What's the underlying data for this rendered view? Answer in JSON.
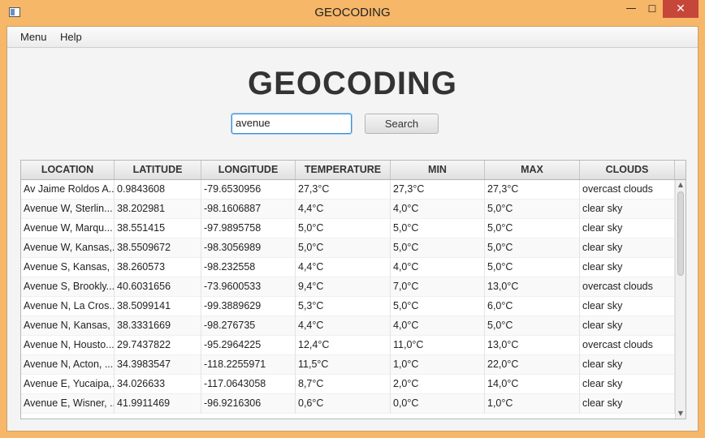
{
  "window": {
    "title": "GEOCODING",
    "minimize_glyph": "—",
    "maximize_glyph": "☐",
    "close_glyph": "✕"
  },
  "menu": {
    "items": [
      "Menu",
      "Help"
    ]
  },
  "main": {
    "heading": "GEOCODING",
    "search_value": "avenue",
    "search_button": "Search"
  },
  "table": {
    "columns": [
      "LOCATION",
      "LATITUDE",
      "LONGITUDE",
      "TEMPERATURE",
      "MIN",
      "MAX",
      "CLOUDS"
    ],
    "rows": [
      [
        "Av Jaime Roldos A...",
        "0.9843608",
        "-79.6530956",
        "27,3°C",
        "27,3°C",
        "27,3°C",
        "overcast clouds"
      ],
      [
        "Avenue W, Sterlin...",
        "38.202981",
        "-98.1606887",
        "4,4°C",
        "4,0°C",
        "5,0°C",
        "clear sky"
      ],
      [
        "Avenue W, Marqu...",
        "38.551415",
        "-97.9895758",
        "5,0°C",
        "5,0°C",
        "5,0°C",
        "clear sky"
      ],
      [
        "Avenue W, Kansas,...",
        "38.5509672",
        "-98.3056989",
        "5,0°C",
        "5,0°C",
        "5,0°C",
        "clear sky"
      ],
      [
        "Avenue S, Kansas, ...",
        "38.260573",
        "-98.232558",
        "4,4°C",
        "4,0°C",
        "5,0°C",
        "clear sky"
      ],
      [
        "Avenue S, Brookly...",
        "40.6031656",
        "-73.9600533",
        "9,4°C",
        "7,0°C",
        "13,0°C",
        "overcast clouds"
      ],
      [
        "Avenue N, La Cros...",
        "38.5099141",
        "-99.3889629",
        "5,3°C",
        "5,0°C",
        "6,0°C",
        "clear sky"
      ],
      [
        "Avenue N, Kansas, ...",
        "38.3331669",
        "-98.276735",
        "4,4°C",
        "4,0°C",
        "5,0°C",
        "clear sky"
      ],
      [
        "Avenue N, Housto...",
        "29.7437822",
        "-95.2964225",
        "12,4°C",
        "11,0°C",
        "13,0°C",
        "overcast clouds"
      ],
      [
        "Avenue N, Acton, ...",
        "34.3983547",
        "-118.2255971",
        "11,5°C",
        "1,0°C",
        "22,0°C",
        "clear sky"
      ],
      [
        "Avenue E, Yucaipa,...",
        "34.026633",
        "-117.0643058",
        "8,7°C",
        "2,0°C",
        "14,0°C",
        "clear sky"
      ],
      [
        "Avenue E, Wisner, ...",
        "41.9911469",
        "-96.9216306",
        "0,6°C",
        "0,0°C",
        "1,0°C",
        "clear sky"
      ]
    ]
  },
  "colors": {
    "window_frame": "#f6b768",
    "close_button": "#c7463a",
    "input_focus": "#3c8fd8"
  }
}
